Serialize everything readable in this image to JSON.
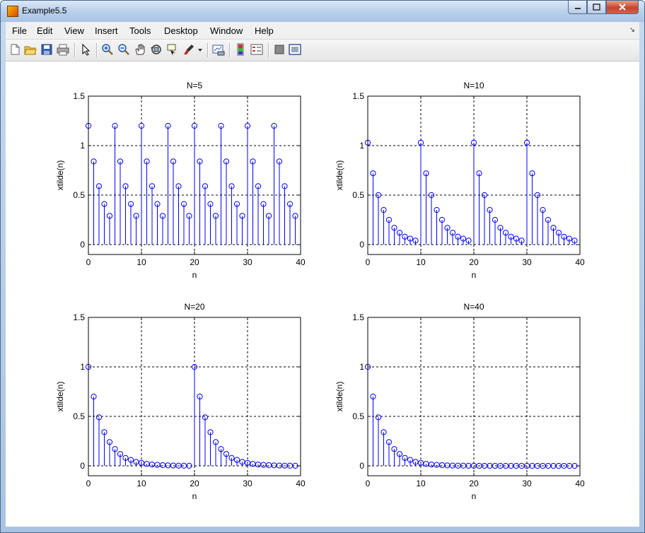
{
  "window": {
    "title": "Example5.5"
  },
  "menu": [
    "File",
    "Edit",
    "View",
    "Insert",
    "Tools",
    "Desktop",
    "Window",
    "Help"
  ],
  "toolbar": [
    "new-figure",
    "open-file",
    "save-figure",
    "print-figure",
    "edit-plot",
    "zoom-in",
    "zoom-out",
    "pan",
    "rotate-3d",
    "data-cursor",
    "brush",
    "brush-dropdown",
    "link-plot",
    "insert-colorbar",
    "insert-legend",
    "hide-plot-tools",
    "show-plot-tools"
  ],
  "chart_data": [
    {
      "type": "stem",
      "title": "N=5",
      "xlabel": "n",
      "ylabel": "xtilde(n)",
      "xlim": [
        0,
        40
      ],
      "ylim": [
        -0.1,
        1.5
      ],
      "xticks": [
        0,
        10,
        20,
        30,
        40
      ],
      "yticks": [
        0,
        0.5,
        1,
        1.5
      ],
      "grid": true,
      "x": [
        0,
        1,
        2,
        3,
        4,
        5,
        6,
        7,
        8,
        9,
        10,
        11,
        12,
        13,
        14,
        15,
        16,
        17,
        18,
        19,
        20,
        21,
        22,
        23,
        24,
        25,
        26,
        27,
        28,
        29,
        30,
        31,
        32,
        33,
        34,
        35,
        36,
        37,
        38,
        39
      ],
      "y": [
        1.2,
        0.84,
        0.59,
        0.41,
        0.29,
        1.2,
        0.84,
        0.59,
        0.41,
        0.29,
        1.2,
        0.84,
        0.59,
        0.41,
        0.29,
        1.2,
        0.84,
        0.59,
        0.41,
        0.29,
        1.2,
        0.84,
        0.59,
        0.41,
        0.29,
        1.2,
        0.84,
        0.59,
        0.41,
        0.29,
        1.2,
        0.84,
        0.59,
        0.41,
        0.29,
        1.2,
        0.84,
        0.59,
        0.41,
        0.29
      ]
    },
    {
      "type": "stem",
      "title": "N=10",
      "xlabel": "n",
      "ylabel": "xtilde(n)",
      "xlim": [
        0,
        40
      ],
      "ylim": [
        -0.1,
        1.5
      ],
      "xticks": [
        0,
        10,
        20,
        30,
        40
      ],
      "yticks": [
        0,
        0.5,
        1,
        1.5
      ],
      "grid": true,
      "x": [
        0,
        1,
        2,
        3,
        4,
        5,
        6,
        7,
        8,
        9,
        10,
        11,
        12,
        13,
        14,
        15,
        16,
        17,
        18,
        19,
        20,
        21,
        22,
        23,
        24,
        25,
        26,
        27,
        28,
        29,
        30,
        31,
        32,
        33,
        34,
        35,
        36,
        37,
        38,
        39
      ],
      "y": [
        1.03,
        0.72,
        0.5,
        0.35,
        0.25,
        0.17,
        0.12,
        0.08,
        0.06,
        0.04,
        1.03,
        0.72,
        0.5,
        0.35,
        0.25,
        0.17,
        0.12,
        0.08,
        0.06,
        0.04,
        1.03,
        0.72,
        0.5,
        0.35,
        0.25,
        0.17,
        0.12,
        0.08,
        0.06,
        0.04,
        1.03,
        0.72,
        0.5,
        0.35,
        0.25,
        0.17,
        0.12,
        0.08,
        0.06,
        0.04
      ]
    },
    {
      "type": "stem",
      "title": "N=20",
      "xlabel": "n",
      "ylabel": "xtilde(n)",
      "xlim": [
        0,
        40
      ],
      "ylim": [
        -0.1,
        1.5
      ],
      "xticks": [
        0,
        10,
        20,
        30,
        40
      ],
      "yticks": [
        0,
        0.5,
        1,
        1.5
      ],
      "grid": true,
      "x": [
        0,
        1,
        2,
        3,
        4,
        5,
        6,
        7,
        8,
        9,
        10,
        11,
        12,
        13,
        14,
        15,
        16,
        17,
        18,
        19,
        20,
        21,
        22,
        23,
        24,
        25,
        26,
        27,
        28,
        29,
        30,
        31,
        32,
        33,
        34,
        35,
        36,
        37,
        38,
        39
      ],
      "y": [
        1.0,
        0.7,
        0.49,
        0.34,
        0.24,
        0.17,
        0.12,
        0.08,
        0.06,
        0.04,
        0.03,
        0.02,
        0.014,
        0.01,
        0.007,
        0.005,
        0.003,
        0.002,
        0.0016,
        0.0011,
        1.0,
        0.7,
        0.49,
        0.34,
        0.24,
        0.17,
        0.12,
        0.08,
        0.06,
        0.04,
        0.03,
        0.02,
        0.014,
        0.01,
        0.007,
        0.005,
        0.003,
        0.002,
        0.0016,
        0.0011
      ]
    },
    {
      "type": "stem",
      "title": "N=40",
      "xlabel": "n",
      "ylabel": "xtilde(n)",
      "xlim": [
        0,
        40
      ],
      "ylim": [
        -0.1,
        1.5
      ],
      "xticks": [
        0,
        10,
        20,
        30,
        40
      ],
      "yticks": [
        0,
        0.5,
        1,
        1.5
      ],
      "grid": true,
      "x": [
        0,
        1,
        2,
        3,
        4,
        5,
        6,
        7,
        8,
        9,
        10,
        11,
        12,
        13,
        14,
        15,
        16,
        17,
        18,
        19,
        20,
        21,
        22,
        23,
        24,
        25,
        26,
        27,
        28,
        29,
        30,
        31,
        32,
        33,
        34,
        35,
        36,
        37,
        38,
        39
      ],
      "y": [
        1.0,
        0.7,
        0.49,
        0.34,
        0.24,
        0.17,
        0.12,
        0.08,
        0.06,
        0.04,
        0.03,
        0.02,
        0.014,
        0.01,
        0.007,
        0.005,
        0.003,
        0.002,
        0.0016,
        0.0011,
        0.0008,
        0.0006,
        0.0004,
        0.0003,
        0.0002,
        0.0001,
        0.0001,
        0,
        0,
        0,
        0,
        0,
        0,
        0,
        0,
        0,
        0,
        0,
        0,
        0
      ]
    }
  ]
}
